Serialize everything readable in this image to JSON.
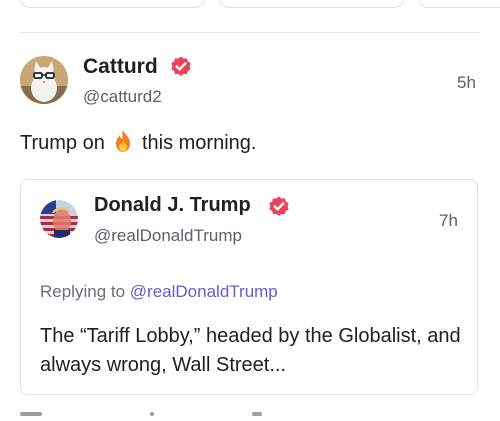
{
  "post": {
    "author_name": "Catturd",
    "author_handle": "@catturd2",
    "time": "5h",
    "text_before": "Trump on",
    "text_after": "this morning."
  },
  "quoted_post": {
    "author_name": "Donald J. Trump",
    "author_handle": "@realDonaldTrump",
    "time": "7h",
    "replying_prefix": "Replying to",
    "replying_handle": "@realDonaldTrump",
    "text": "The “Tariff Lobby,” headed by the Globalist, and always wrong, Wall Street..."
  },
  "icons": {
    "verified": "verified-badge-icon",
    "fire": "fire-emoji-icon"
  },
  "colors": {
    "verified_badge": "#e8455c",
    "link": "#6a5acd",
    "muted_text": "#5c5f66",
    "border": "#dfe1e5"
  }
}
